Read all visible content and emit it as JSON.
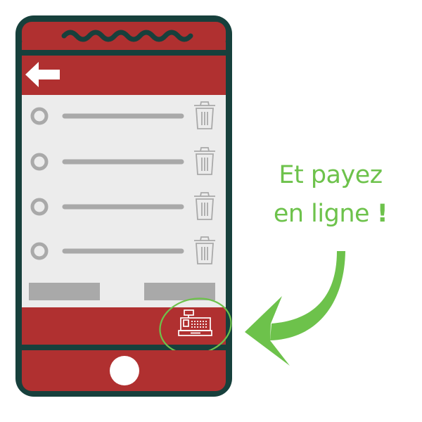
{
  "colors": {
    "frame": "#17403c",
    "bars": "#b03030",
    "list_background": "#ececec",
    "placeholder": "#a9a9a9",
    "accent": "#6dc24b",
    "white": "#ffffff"
  },
  "header": {
    "back_icon": "back-arrow-icon"
  },
  "list": {
    "items": [
      {
        "radio_icon": "radio-icon",
        "delete_icon": "trash-icon"
      },
      {
        "radio_icon": "radio-icon",
        "delete_icon": "trash-icon"
      },
      {
        "radio_icon": "radio-icon",
        "delete_icon": "trash-icon"
      },
      {
        "radio_icon": "radio-icon",
        "delete_icon": "trash-icon"
      }
    ]
  },
  "actions": {
    "left_button": "",
    "right_button": ""
  },
  "footer": {
    "checkout_icon": "cash-register-icon"
  },
  "caption": {
    "line1": "Et payez",
    "line2_text": "en ligne ",
    "line2_mark": "!"
  }
}
